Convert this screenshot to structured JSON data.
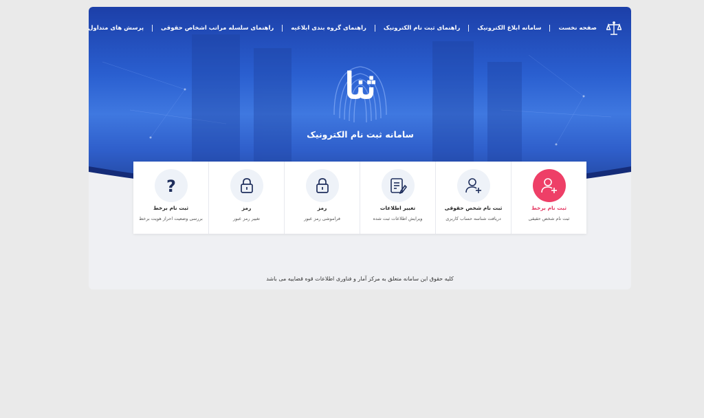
{
  "nav": {
    "items": [
      {
        "label": "صفحه نخست"
      },
      {
        "label": "سامانه ابلاغ الکترونیک"
      },
      {
        "label": "راهنمای ثبت نام الکترونیک"
      },
      {
        "label": "راهنمای گروه بندی ابلاغیه"
      },
      {
        "label": "راهنمای سلسله مراتب اشخاص حقوقی"
      },
      {
        "label": "پرسش های متداول"
      }
    ],
    "logo_icon": "scales-of-justice-icon"
  },
  "brand": {
    "mark": "ثنا",
    "title": "سامانه ثبت نام الکترونیک"
  },
  "cards": [
    {
      "title": "ثبت نام برخط",
      "subtitle": "ثبت نام شخص حقیقی",
      "icon": "user-plus-icon",
      "active": true
    },
    {
      "title": "ثبت نام شخص حقوقی",
      "subtitle": "دریافت شناسه حساب کاربری",
      "icon": "user-plus-icon",
      "active": false
    },
    {
      "title": "تغییر اطلاعات",
      "subtitle": "ویرایش اطلاعات ثبت شده",
      "icon": "edit-document-icon",
      "active": false
    },
    {
      "title": "رمز",
      "subtitle": "فراموشی رمز عبور",
      "icon": "lock-icon",
      "active": false
    },
    {
      "title": "رمز",
      "subtitle": "تغییر رمز عبور",
      "icon": "lock-icon",
      "active": false
    },
    {
      "title": "ثبت نام برخط",
      "subtitle": "بررسی وضعیت احراز هویت برخط",
      "icon": "question-mark-icon",
      "active": false
    }
  ],
  "footer": {
    "text": "کلیه حقوق این سامانه متعلق به مرکز آمار و فناوری اطلاعات قوه قضاییه می باشد"
  },
  "colors": {
    "hero_blue": "#2a5fd0",
    "accent_pink": "#ee3f67",
    "icon_navy": "#1e2e5c"
  }
}
